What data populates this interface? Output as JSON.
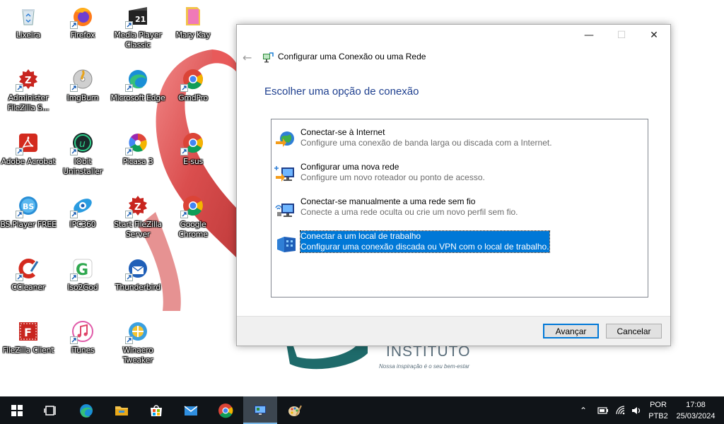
{
  "desktop": {
    "icons": [
      {
        "label": "Lixeira",
        "icon": "recycle-bin-icon"
      },
      {
        "label": "Firefox",
        "icon": "firefox-icon"
      },
      {
        "label": "Media Player Classic",
        "icon": "media-player-classic-icon"
      },
      {
        "label": "Mary Kay",
        "icon": "folder-icon"
      },
      {
        "label": "Administer FileZilla S...",
        "icon": "filezilla-server-icon"
      },
      {
        "label": "ImgBurn",
        "icon": "imgburn-icon"
      },
      {
        "label": "Microsoft Edge",
        "icon": "edge-icon"
      },
      {
        "label": "GmdPro",
        "icon": "chrome-icon"
      },
      {
        "label": "Adobe Acrobat",
        "icon": "acrobat-icon"
      },
      {
        "label": "IObit Uninstaller",
        "icon": "iobit-uninstaller-icon"
      },
      {
        "label": "Picasa 3",
        "icon": "picasa-icon"
      },
      {
        "label": "E-sus",
        "icon": "chrome-icon"
      },
      {
        "label": "BS.Player FREE",
        "icon": "bsplayer-icon"
      },
      {
        "label": "IPC360",
        "icon": "ipc360-icon"
      },
      {
        "label": "Start FileZilla Server",
        "icon": "filezilla-server-icon"
      },
      {
        "label": "Google Chrome",
        "icon": "chrome-icon"
      },
      {
        "label": "CCleaner",
        "icon": "ccleaner-icon"
      },
      {
        "label": "Iso2God",
        "icon": "iso2god-icon"
      },
      {
        "label": "Thunderbird",
        "icon": "thunderbird-icon"
      },
      {
        "label": "FileZilla Client",
        "icon": "filezilla-client-icon"
      },
      {
        "label": "iTunes",
        "icon": "itunes-icon"
      },
      {
        "label": "Winaero Tweaker",
        "icon": "winaero-tweaker-icon"
      }
    ],
    "wallpaper_brand": "INSTITUTO",
    "wallpaper_slogan": "Nossa inspiração é o seu bem-estar"
  },
  "dialog": {
    "title": "Configurar uma Conexão ou uma Rede",
    "heading": "Escolher uma opção de conexão",
    "back_icon": "back-arrow-icon",
    "controls": {
      "minimize": "—",
      "maximize": "☐",
      "close": "✕"
    },
    "options": [
      {
        "title": "Conectar-se à Internet",
        "desc": "Configure uma conexão de banda larga ou discada com a Internet.",
        "icon": "globe-network-icon",
        "selected": false
      },
      {
        "title": "Configurar uma nova rede",
        "desc": "Configure um novo roteador ou ponto de acesso.",
        "icon": "router-network-icon",
        "selected": false
      },
      {
        "title": "Conectar-se manualmente a uma rede sem fio",
        "desc": "Conecte a uma rede oculta ou crie um novo perfil sem fio.",
        "icon": "wireless-network-icon",
        "selected": false
      },
      {
        "title": "Conectar a um local de trabalho",
        "desc": "Configurar uma conexão discada ou VPN com o local de trabalho.",
        "icon": "workplace-vpn-icon",
        "selected": true
      }
    ],
    "next_label": "Avançar",
    "cancel_label": "Cancelar"
  },
  "taskbar": {
    "pinned": [
      "start-icon",
      "task-view-icon",
      "edge-icon",
      "file-explorer-icon",
      "store-icon",
      "mail-icon",
      "chrome-icon",
      "network-wizard-icon",
      "paint-icon"
    ],
    "language": "POR",
    "keyboard": "PTB2",
    "time": "17:08",
    "date": "25/03/2024"
  },
  "colors": {
    "accent": "#0078d7",
    "heading": "#1e3f8f",
    "taskbar": "#101418",
    "ribbon": "#d63a3a"
  }
}
